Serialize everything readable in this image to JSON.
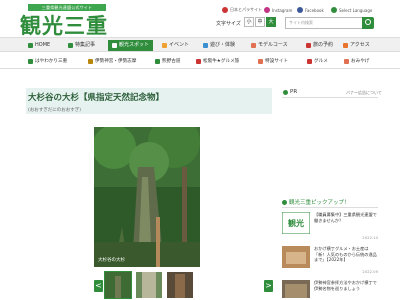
{
  "header": {
    "tagline": "三重県観光連盟公式サイト",
    "logo": "観光三重",
    "social": [
      "日本とパラサイト",
      "Instagram",
      "Facebook",
      "Select Language"
    ],
    "font_size_label": "文字サイズ",
    "font_sizes": [
      "小",
      "中",
      "大"
    ],
    "search_placeholder": "サイト内検索"
  },
  "nav_primary": [
    {
      "label": "HOME",
      "active": false
    },
    {
      "label": "特集記事",
      "active": false
    },
    {
      "label": "観光スポット",
      "active": true
    },
    {
      "label": "イベント",
      "active": false
    },
    {
      "label": "遊び・体験",
      "active": false
    },
    {
      "label": "モデルコース",
      "active": false
    },
    {
      "label": "旅の予約",
      "active": false
    },
    {
      "label": "アクセス",
      "active": false
    }
  ],
  "nav_secondary": [
    "はやわかり三重",
    "伊勢神宮・伊勢志摩",
    "熊野古道",
    "松阪牛★グルメ旅",
    "特設サイト",
    "グルメ",
    "おみやげ"
  ],
  "page": {
    "title": "大杉谷の大杉【県指定天然記念物】",
    "reading": "(おおすぎだにのおおすぎ)",
    "photo_caption": "大杉谷の大杉",
    "prev_arrow": "<",
    "next_arrow": ">"
  },
  "sidebar": {
    "pr_label": "PR",
    "pr_link": "バナー広告について",
    "pickup_title": "観光三重ピックアップ！",
    "pickups": [
      {
        "text": "【職員募集中】三重県観光連盟で働きませんか？",
        "date": "2022.10"
      },
      {
        "text": "おかげ横丁グルメ・お土産は「新！人気のものから伝統の逸品まで」【2022年】",
        "date": "2022.09"
      },
      {
        "text": "伊勢神宮参拝方法やおかげ横丁で伊勢名物を巡りましょう",
        "date": ""
      }
    ]
  },
  "colors": {
    "brand_green": "#2f8d3c",
    "title_bg": "#e6f2ef"
  }
}
